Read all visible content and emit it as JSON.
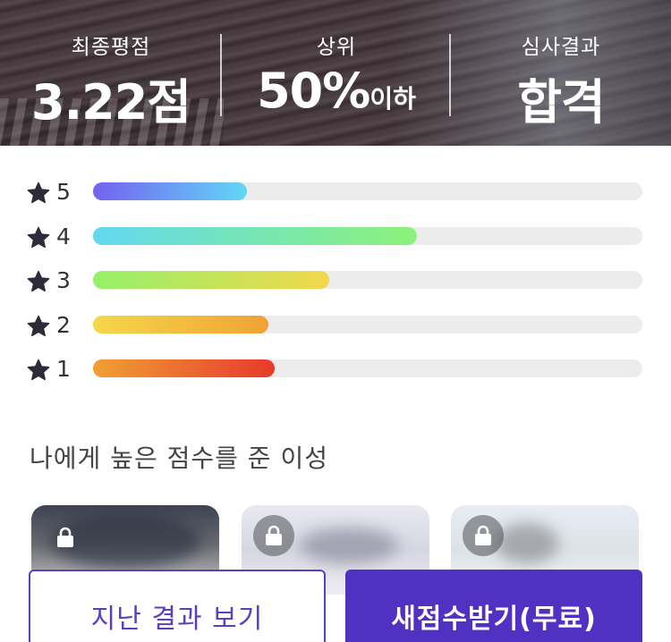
{
  "header": {
    "final_score": {
      "label": "최종평점",
      "value": "3.22점"
    },
    "rank": {
      "label": "상위",
      "value": "50%",
      "suffix": "이하"
    },
    "result": {
      "label": "심사결과",
      "value": "합격"
    }
  },
  "ratings": [
    {
      "stars": "5",
      "fraction": 0.28,
      "colors": [
        "#7461f0",
        "#62d7f6"
      ]
    },
    {
      "stars": "4",
      "fraction": 0.59,
      "colors": [
        "#62d8f0",
        "#8cf27a"
      ]
    },
    {
      "stars": "3",
      "fraction": 0.43,
      "colors": [
        "#95f06a",
        "#f2d84a"
      ]
    },
    {
      "stars": "2",
      "fraction": 0.32,
      "colors": [
        "#f4d84a",
        "#f0a235"
      ]
    },
    {
      "stars": "1",
      "fraction": 0.33,
      "colors": [
        "#f0a034",
        "#e8392c"
      ]
    }
  ],
  "section": {
    "title": "나에게 높은 점수를 준 이성"
  },
  "cards": [
    {
      "icon": "lock-icon"
    },
    {
      "icon": "lock-icon"
    },
    {
      "icon": "lock-icon"
    }
  ],
  "buttons": {
    "past_results": "지난 결과 보기",
    "get_new_score": "새점수받기(무료)"
  },
  "colors": {
    "accent": "#5131c2",
    "star": "#2b2b3a",
    "track": "#ececec"
  }
}
